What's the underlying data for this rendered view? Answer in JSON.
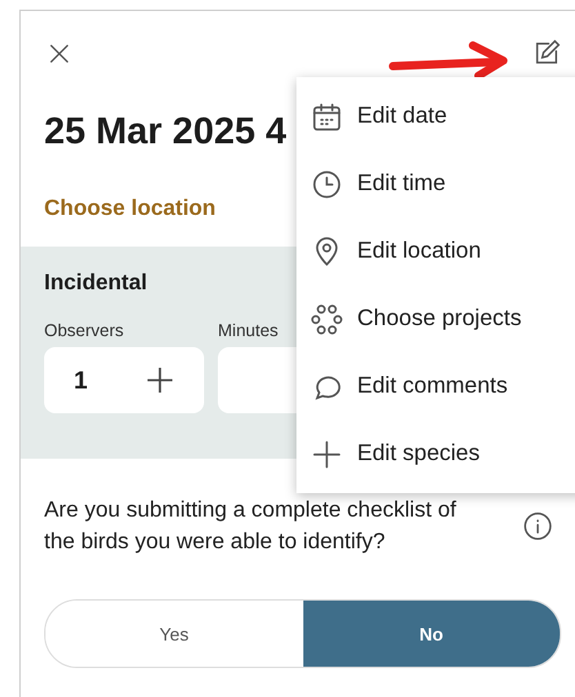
{
  "header": {
    "title": "25 Mar 2025 4"
  },
  "location_link": "Choose location",
  "protocol": {
    "title": "Incidental",
    "fields": [
      {
        "label": "Observers",
        "value": "1",
        "kind": "stepper"
      },
      {
        "label": "Minutes",
        "kind": "blank"
      }
    ]
  },
  "menu": [
    {
      "label": "Edit date",
      "kind": "calendar"
    },
    {
      "label": "Edit time",
      "kind": "clock"
    },
    {
      "label": "Edit location",
      "kind": "pin"
    },
    {
      "label": "Choose projects",
      "kind": "circles"
    },
    {
      "label": "Edit comments",
      "kind": "bubble"
    },
    {
      "label": "Edit species",
      "kind": "plus"
    }
  ],
  "question": "Are you submitting a complete checklist of the birds you were able to identify?",
  "answer_options": [
    {
      "label": "Yes",
      "selected": false
    },
    {
      "label": "No",
      "selected": true
    }
  ]
}
